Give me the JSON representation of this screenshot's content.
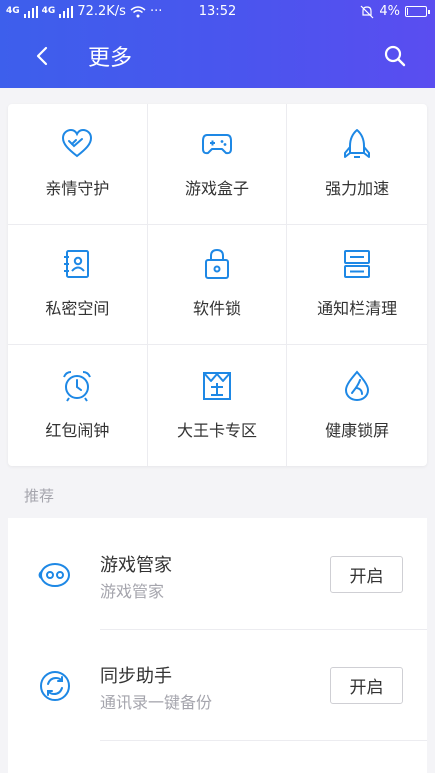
{
  "status_bar": {
    "signal_1": "4G",
    "signal_2": "4G",
    "speed": "72.2K/s",
    "more": "···",
    "time": "13:52",
    "battery": "4%",
    "battery_level": 0.04
  },
  "header": {
    "title": "更多"
  },
  "grid": {
    "items": [
      {
        "label": "亲情守护",
        "icon": "heart-hand-icon"
      },
      {
        "label": "游戏盒子",
        "icon": "gamepad-icon"
      },
      {
        "label": "强力加速",
        "icon": "rocket-icon"
      },
      {
        "label": "私密空间",
        "icon": "contact-book-icon"
      },
      {
        "label": "软件锁",
        "icon": "lock-icon"
      },
      {
        "label": "通知栏清理",
        "icon": "notification-clean-icon"
      },
      {
        "label": "红包闹钟",
        "icon": "alarm-clock-icon"
      },
      {
        "label": "大王卡专区",
        "icon": "king-card-icon"
      },
      {
        "label": "健康锁屏",
        "icon": "leaf-drop-icon"
      }
    ]
  },
  "recommend": {
    "section_title": "推荐",
    "items": [
      {
        "title": "游戏管家",
        "subtitle": "游戏管家",
        "button": "开启",
        "icon": "game-butler-icon"
      },
      {
        "title": "同步助手",
        "subtitle": "通讯录一键备份",
        "button": "开启",
        "icon": "sync-icon"
      }
    ]
  },
  "colors": {
    "header_gradient_start": "#3d5fec",
    "header_gradient_end": "#5a4df0",
    "icon_blue": "#1e88e5",
    "background": "#f4f4f7"
  }
}
